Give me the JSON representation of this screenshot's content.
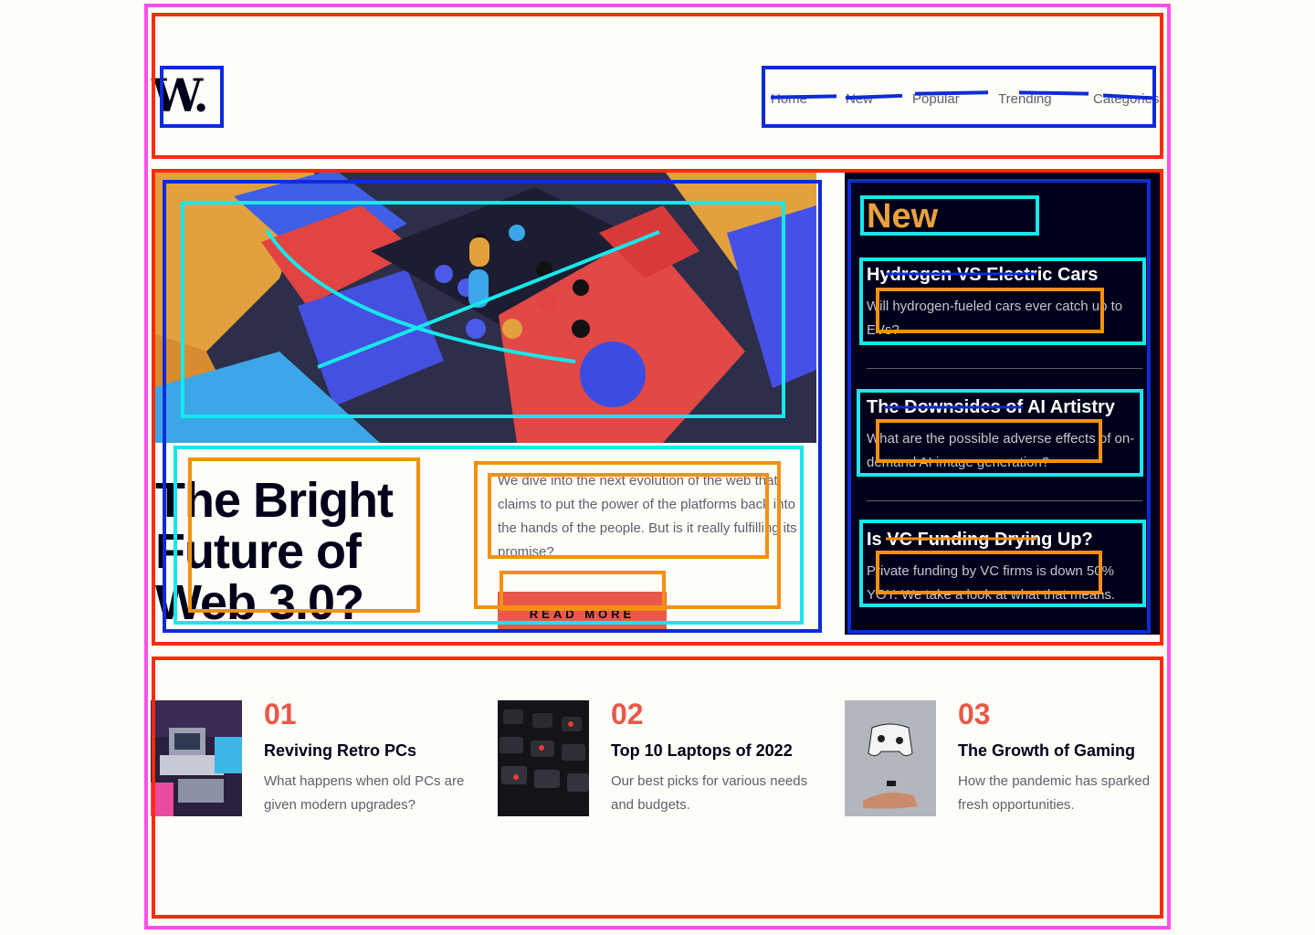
{
  "header": {
    "logo": "W.",
    "nav": [
      "Home",
      "New",
      "Popular",
      "Trending",
      "Categories"
    ]
  },
  "hero": {
    "title": "The Bright Future of Web 3.0?",
    "description": "We dive into the next evolution of the web that claims to put the power of the platforms back into the hands of the people. But is it really fulfilling its promise?",
    "cta": "READ MORE"
  },
  "sidebar": {
    "heading": "New",
    "items": [
      {
        "title": "Hydrogen VS Electric Cars",
        "text": "Will hydrogen-fueled cars ever catch up to EVs?"
      },
      {
        "title": "The Downsides of AI Artistry",
        "text": "What are the possible adverse effects of on-demand AI image generation?"
      },
      {
        "title": "Is VC Funding Drying Up?",
        "text": "Private funding by VC firms is down 50% YOY. We take a look at what that means."
      }
    ]
  },
  "articles": [
    {
      "number": "01",
      "title": "Reviving Retro PCs",
      "text": "What happens when old PCs are given modern upgrades?"
    },
    {
      "number": "02",
      "title": "Top 10 Laptops of 2022",
      "text": "Our best picks for various needs and budgets."
    },
    {
      "number": "03",
      "title": "The Growth of Gaming",
      "text": "How the pandemic has sparked fresh opportunities."
    }
  ],
  "colors": {
    "background": "#fffdf8",
    "ink": "#00001a",
    "accent_red": "#e9584a",
    "accent_orange": "#e9a23b",
    "muted": "#5d5f6d"
  }
}
